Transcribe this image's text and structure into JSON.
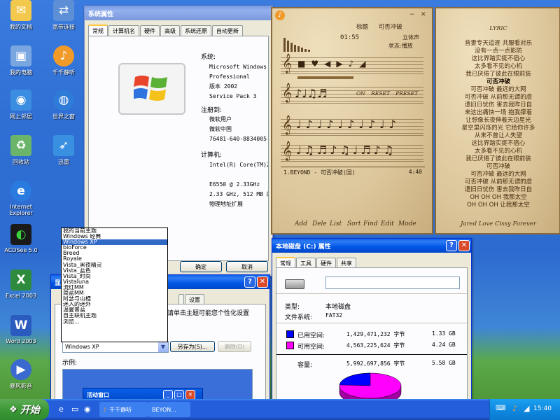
{
  "desktop": {
    "icons": [
      {
        "label": "我的文档",
        "color": "#f2c94c"
      },
      {
        "label": "宽带连接",
        "color": "#5c8fd6"
      },
      {
        "label": "我的电脑",
        "color": "#7aa6e0"
      },
      {
        "label": "千千静听",
        "color": "#f09a2a"
      },
      {
        "label": "网上邻居",
        "color": "#3a8de0"
      },
      {
        "label": "世界之窗",
        "color": "#2e7bd8"
      },
      {
        "label": "回收站",
        "color": "#6ab56a"
      },
      {
        "label": "迅雷",
        "color": "#3a90e0"
      },
      {
        "label": "Internet Explorer",
        "color": "#2a7be0"
      },
      {
        "label": "ACDSee 5.0",
        "color": "#1a1a1a"
      },
      {
        "label": "Excel 2003",
        "color": "#2e8b3e"
      },
      {
        "label": "Word 2003",
        "color": "#2b5bbf"
      },
      {
        "label": "暴风影音",
        "color": "#3a6ad0"
      }
    ]
  },
  "sysprops": {
    "title": "系统属性",
    "tabs": [
      "常规",
      "计算机名",
      "硬件",
      "高级",
      "系统还原",
      "自动更新"
    ],
    "system_label": "系统:",
    "system_lines": [
      "Microsoft Windows X",
      "Professional",
      "版本 2002",
      "Service Pack 3"
    ],
    "registered_label": "注册到:",
    "registered_lines": [
      "微软用户",
      "微软中国",
      "76481-640-8834005-2"
    ],
    "computer_label": "计算机:",
    "computer_lines": [
      "Intel(R) Core(TM)2",
      "",
      "E6550 @ 2.33GHz",
      "2.33 GHz, 512 MB 的",
      "物理地址扩展"
    ],
    "ok": "确定",
    "cancel": "取消"
  },
  "display": {
    "title_initial": "显",
    "tab_settings": "设置",
    "hint": "请单击主题可能您个性化设置",
    "combo_value": "Windows XP",
    "save_as": "另存为(S)...",
    "delete": "删除(D)",
    "example_label": "示例:",
    "preview_title": "活动窗口"
  },
  "theme_list": {
    "items": [
      "我的当前主题",
      "Windows 经典",
      "Windows XP",
      "bioForce",
      "Breed",
      "Royale",
      "Vista_黑夜精灵",
      "Vista_蓝色",
      "Vista_时尚",
      "Vistaluna",
      "流红MM",
      "简蓝MM",
      "阿瑟与山楂",
      "迷入的迷外",
      "温馨普蓝",
      "自主联机主题",
      "浏览..."
    ],
    "selected": "Windows XP"
  },
  "player": {
    "title_label": "标题",
    "title_value": "可否冲破",
    "time": "01:55",
    "stereo": "立体声",
    "status_label": "状态:",
    "status_value": "播放",
    "mode_buttons": [
      "ON",
      "RESET",
      "PRESET"
    ],
    "playlist": [
      {
        "name": "1.BEYOND - 可否冲破(国)",
        "duration": "4:40"
      }
    ],
    "menu": [
      "Add",
      "Dele",
      "List",
      "Sort",
      "Find",
      "Edit",
      "Mode"
    ]
  },
  "lyrics": {
    "title": "LYRIC",
    "lines": [
      "曾妻专天追逐 共服看对乐",
      "没有一点一点影防",
      "这比界踏实挺不宿心",
      "太多看不见的心机",
      "我已厌倦了彼此在眼前装",
      "可否冲破",
      "可否冲破 最远的大网",
      "可否冲破 从前那无谓的虚",
      "遗旧日忧伤 害去我昨日自",
      "来这出痛快一场 抱我撑着",
      "让想像长夜伸着天边星光",
      "星空里闪烁的光 它给你许多",
      "从来不曾让人失望",
      "这比界踏实挺不宿心",
      "太多看不见的心机",
      "我已厌倦了彼此在眼前装",
      "可否冲破",
      "可否冲破 最远的大网",
      "可否冲破 从前那无谓的虚",
      "遗旧日忧伤 害去我昨日自",
      "OH OH OH 我那太空",
      "OH OH OH 让我那太空"
    ],
    "highlight_index": 5,
    "footer": "Jared Love Cissy Forever"
  },
  "disk": {
    "title": "本地磁盘 (C:) 属性",
    "tabs": [
      "常规",
      "工具",
      "硬件",
      "共享"
    ],
    "name_value": "",
    "type_label": "类型:",
    "type_value": "本地磁盘",
    "fs_label": "文件系统:",
    "fs_value": "FAT32",
    "used_label": "已用空间:",
    "used_bytes": "1,429,471,232 字节",
    "used_gb": "1.33 GB",
    "used_color": "#0000ff",
    "free_label": "可用空间:",
    "free_bytes": "4,563,225,624 字节",
    "free_gb": "4.24 GB",
    "free_color": "#ff00ff",
    "cap_label": "容量:",
    "cap_bytes": "5,992,697,856 字节",
    "cap_gb": "5.58 GB",
    "used_fraction": 0.24
  },
  "taskbar": {
    "start": "开始",
    "tasks": [
      "千千静听",
      "BEYON..."
    ],
    "clock": "15:40"
  }
}
